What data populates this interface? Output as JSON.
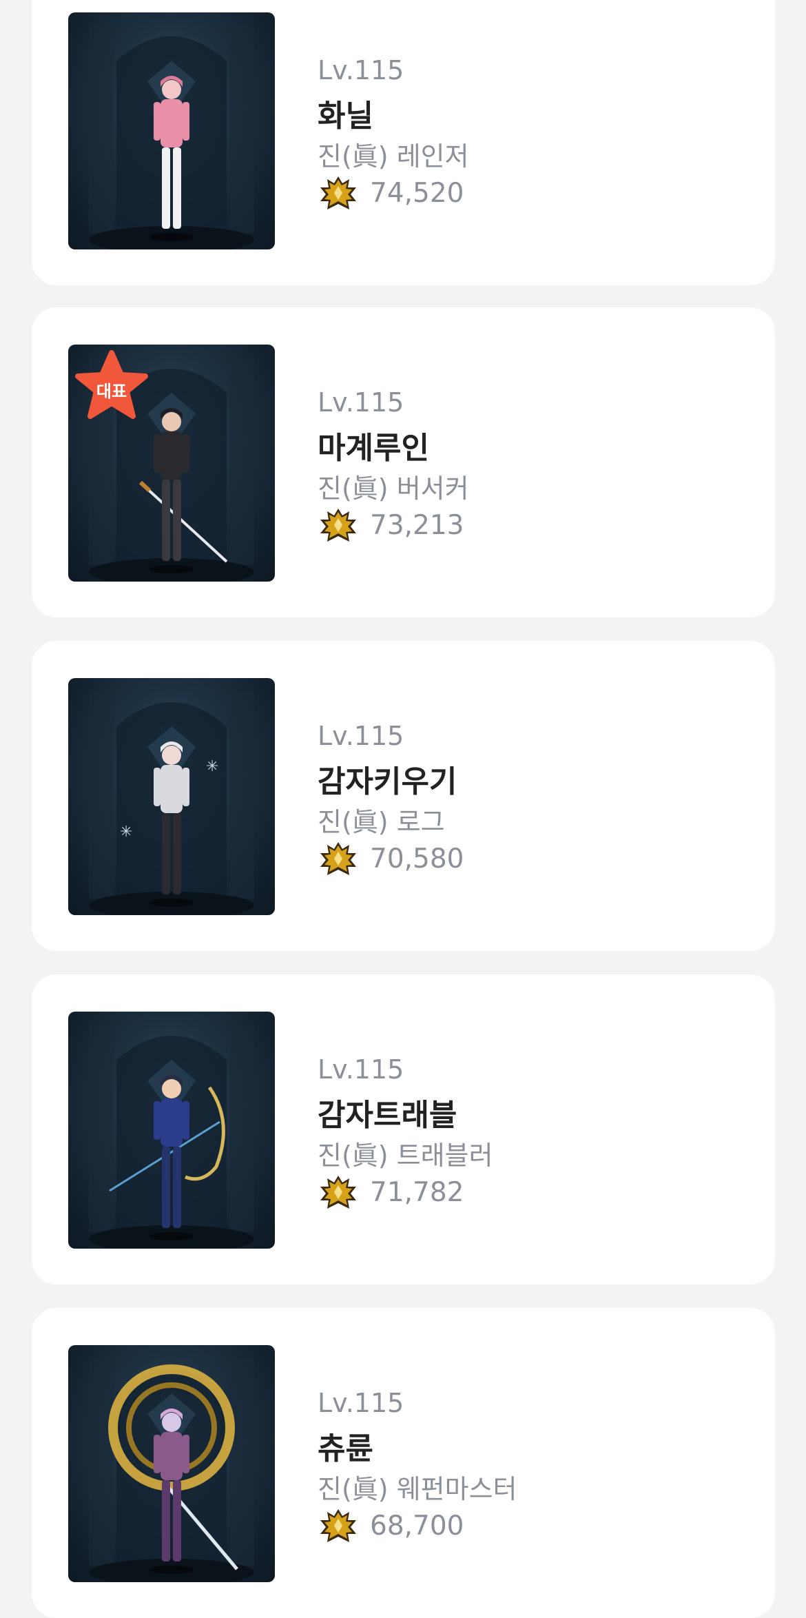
{
  "characters": [
    {
      "level": "Lv.115",
      "name": "화닐",
      "job": "진(眞) 레인저",
      "power": "74,520",
      "representative": false
    },
    {
      "level": "Lv.115",
      "name": "마계루인",
      "job": "진(眞) 버서커",
      "power": "73,213",
      "representative": true,
      "badge": "대표"
    },
    {
      "level": "Lv.115",
      "name": "감자키우기",
      "job": "진(眞) 로그",
      "power": "70,580",
      "representative": false
    },
    {
      "level": "Lv.115",
      "name": "감자트래블",
      "job": "진(眞) 트래블러",
      "power": "71,782",
      "representative": false
    },
    {
      "level": "Lv.115",
      "name": "츄륜",
      "job": "진(眞) 웨펀마스터",
      "power": "68,700",
      "representative": false
    }
  ],
  "colors": {
    "background": "#f2f3f5",
    "card": "#ffffff",
    "name": "#222222",
    "secondary": "#8a8f98",
    "badge": "#f0573b",
    "power_icon": "#d6a21a"
  },
  "icons": {
    "power": "crest-icon",
    "badge": "star-badge-icon"
  }
}
